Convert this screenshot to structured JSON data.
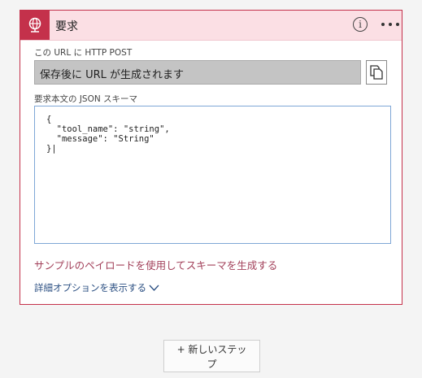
{
  "action_card": {
    "title": "要求",
    "icon": "globe-icon",
    "info_icon": "i",
    "url_label": "この URL に HTTP POST",
    "url_value": "保存後に URL が生成されます",
    "schema_label": "要求本文の JSON スキーマ",
    "schema_lines": [
      "{",
      "  \"tool_name\": \"string\",",
      "  \"message\": \"String\"",
      "}|"
    ],
    "generate_link": "サンプルのペイロードを使用してスキーマを生成する",
    "advanced_link": "詳細オプションを表示する"
  },
  "new_step": {
    "line1": "+ 新しいステッ",
    "line2": "プ"
  },
  "colors": {
    "accent": "#c4314b",
    "header_bg": "#fbdfe4",
    "link": "#a2405a",
    "adv_link": "#2b4f82"
  }
}
